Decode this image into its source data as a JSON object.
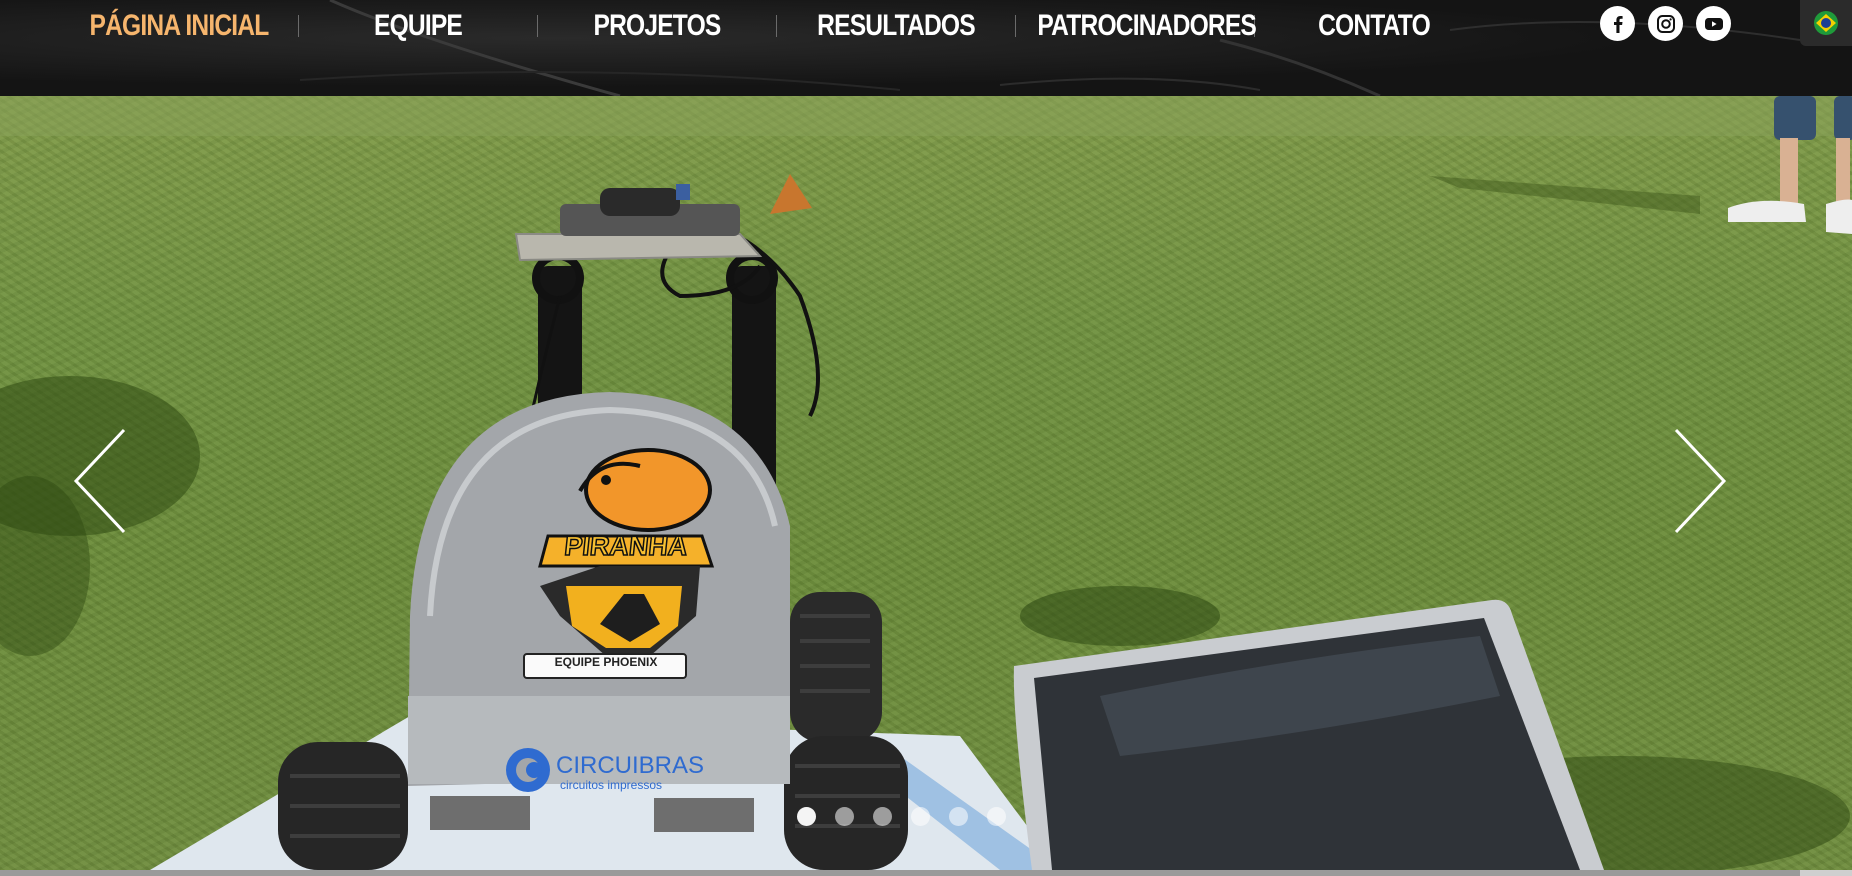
{
  "nav": {
    "items": [
      {
        "label": "PÁGINA INICIAL",
        "active": true
      },
      {
        "label": "EQUIPE",
        "active": false
      },
      {
        "label": "PROJETOS",
        "active": false
      },
      {
        "label": "RESULTADOS",
        "active": false
      },
      {
        "label": "PATROCINADORES",
        "active": false
      },
      {
        "label": "CONTATO",
        "active": false
      }
    ]
  },
  "socials": [
    {
      "icon": "facebook-icon"
    },
    {
      "icon": "instagram-icon"
    },
    {
      "icon": "youtube-icon"
    }
  ],
  "language": {
    "icon": "brazil-flag-icon"
  },
  "slideshow": {
    "slide_count": 6,
    "active_index": 0,
    "robot_labels": {
      "team_badge": "PIRANHA",
      "team_name": "EQUIPE PHOENIX",
      "sponsor_name": "CIRCUIBRAS",
      "sponsor_tagline": "circuitos impressos"
    }
  },
  "colors": {
    "nav_active": "#f6b56d",
    "nav_text": "#ffffff",
    "header_bg": "#141414"
  }
}
